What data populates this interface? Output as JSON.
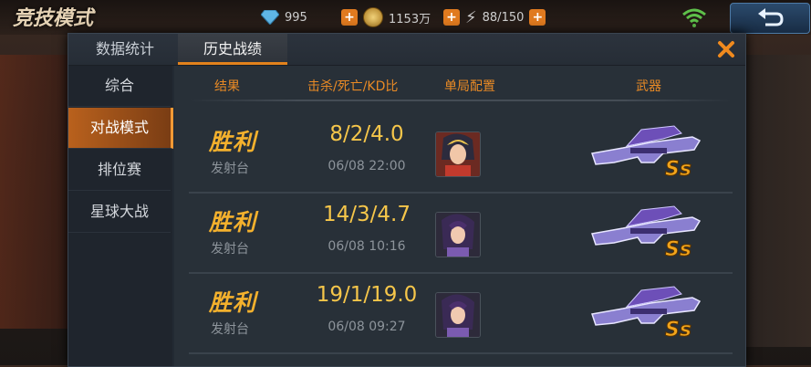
{
  "topbar": {
    "mode_title": "竞技模式",
    "gems": "995",
    "coins": "1153万",
    "energy": "88/150"
  },
  "tabs": {
    "stats": "数据统计",
    "history": "历史战绩"
  },
  "sidebar": {
    "items": [
      {
        "label": "综合"
      },
      {
        "label": "对战模式"
      },
      {
        "label": "排位赛"
      },
      {
        "label": "星球大战"
      }
    ]
  },
  "table": {
    "headers": {
      "result": "结果",
      "kd": "击杀/死亡/KD比",
      "loadout": "单局配置",
      "weapon": "武器"
    },
    "rows": [
      {
        "result": "胜利",
        "map": "发射台",
        "kd": "8/2/4.0",
        "time": "06/08 22:00",
        "weapon_grade": "Ss"
      },
      {
        "result": "胜利",
        "map": "发射台",
        "kd": "14/3/4.7",
        "time": "06/08 10:16",
        "weapon_grade": "Ss"
      },
      {
        "result": "胜利",
        "map": "发射台",
        "kd": "19/1/19.0",
        "time": "06/08 09:27",
        "weapon_grade": "Ss"
      }
    ]
  },
  "colors": {
    "accent": "#e2821c",
    "win": "#f4b12d",
    "kd": "#f6c64a"
  }
}
